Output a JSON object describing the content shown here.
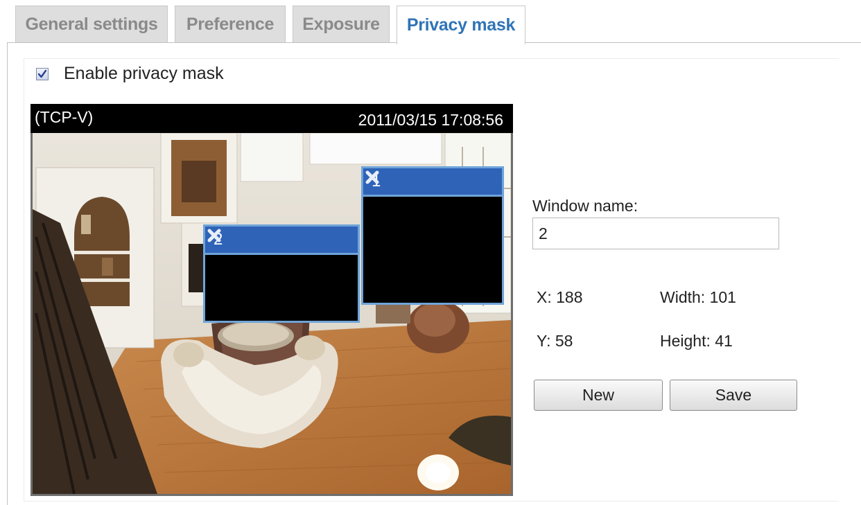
{
  "tabs": [
    {
      "label": "General settings",
      "active": false
    },
    {
      "label": "Preference",
      "active": false
    },
    {
      "label": "Exposure",
      "active": false
    },
    {
      "label": "Privacy mask",
      "active": true
    }
  ],
  "privacy": {
    "enable_label": "Enable privacy mask",
    "enabled": true
  },
  "video": {
    "camera_name": "(TCP-V)",
    "timestamp": "2011/03/15  17:08:56"
  },
  "masks": [
    {
      "name": "1",
      "close_icon": "close-x-icon"
    },
    {
      "name": "2",
      "close_icon": "close-x-icon"
    }
  ],
  "form": {
    "window_name_label": "Window name:",
    "window_name_value": "2",
    "x_label": "X: 188",
    "y_label": "Y: 58",
    "width_label": "Width: 101",
    "height_label": "Height: 41",
    "new_label": "New",
    "save_label": "Save"
  },
  "colors": {
    "active_tab": "#2f74b6",
    "mask_bar": "#2f63b8",
    "mask_border": "#6fa4d8"
  }
}
